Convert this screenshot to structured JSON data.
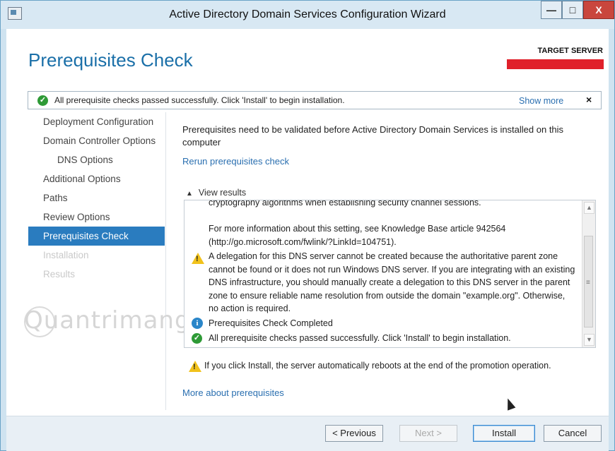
{
  "window": {
    "title": "Active Directory Domain Services Configuration Wizard",
    "controls": {
      "minimize": "—",
      "maximize": "□",
      "close": "X"
    }
  },
  "header": {
    "page_title": "Prerequisites Check",
    "target_server_label": "TARGET SERVER"
  },
  "notice": {
    "text": "All prerequisite checks passed successfully.  Click 'Install' to begin installation.",
    "show_more": "Show more",
    "close": "×"
  },
  "nav": {
    "items": [
      {
        "label": "Deployment Configuration",
        "state": "normal"
      },
      {
        "label": "Domain Controller Options",
        "state": "normal"
      },
      {
        "label": "DNS Options",
        "state": "sub"
      },
      {
        "label": "Additional Options",
        "state": "normal"
      },
      {
        "label": "Paths",
        "state": "normal"
      },
      {
        "label": "Review Options",
        "state": "normal"
      },
      {
        "label": "Prerequisites Check",
        "state": "active"
      },
      {
        "label": "Installation",
        "state": "disabled"
      },
      {
        "label": "Results",
        "state": "disabled"
      }
    ]
  },
  "main": {
    "intro": "Prerequisites need to be validated before Active Directory Domain Services is installed on this computer",
    "rerun_link": "Rerun prerequisites check",
    "view_results": "View results",
    "results": {
      "line_cut": "cryptography algorithms when establishing security channel sessions.",
      "more_info": "For more information about this setting, see Knowledge Base article 942564 (http://go.microsoft.com/fwlink/?LinkId=104751).",
      "dns_warning": "A delegation for this DNS server cannot be created because the authoritative parent zone cannot be found or it does not run Windows DNS server. If you are integrating with an existing DNS infrastructure, you should manually create a delegation to this DNS server in the parent zone to ensure reliable name resolution from outside the domain \"example.org\". Otherwise, no action is required.",
      "completed": "Prerequisites Check Completed",
      "passed": "All prerequisite checks passed successfully.  Click 'Install' to begin installation."
    },
    "reboot_warning": "If you click Install, the server automatically reboots at the end of the promotion operation.",
    "more_link": "More about prerequisites"
  },
  "footer": {
    "previous": "< Previous",
    "next": "Next >",
    "install": "Install",
    "cancel": "Cancel"
  },
  "watermark": "Quantrimang",
  "colors": {
    "accent": "#2a7cbf",
    "title_blue": "#1a6fa8",
    "target_bar": "#e0202a",
    "success": "#2e9a36",
    "warning": "#f1c21b"
  }
}
